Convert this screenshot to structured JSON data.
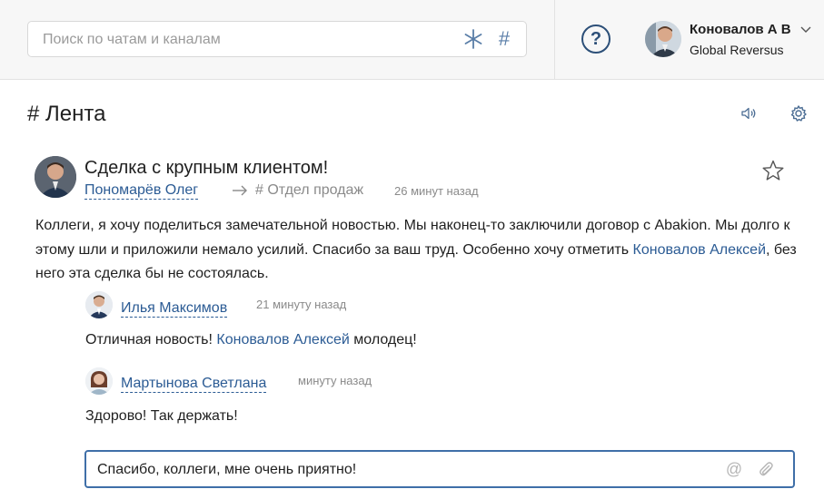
{
  "header": {
    "search": {
      "placeholder": "Поиск по чатам и каналам",
      "value": ""
    },
    "hash_symbol": "#",
    "help_symbol": "?",
    "user": {
      "name": "Коновалов А В",
      "company": "Global Reversus"
    }
  },
  "channel": {
    "title": "# Лента"
  },
  "post": {
    "title": "Сделка с крупным клиентом!",
    "author": "Пономарёв Олег",
    "channel": "# Отдел продаж",
    "time": "26 минут назад",
    "body_part1": "Коллеги, я хочу поделиться замечательной новостью. Мы наконец-то заключили договор с Abakion. Мы долго к этому шли и приложили немало усилий. Спасибо за ваш труд. Особенно хочу отметить ",
    "body_mention": "Коновалов Алексей",
    "body_part2": ", без него эта сделка бы не состоялась."
  },
  "comments": [
    {
      "author": "Илья Максимов",
      "time": "21 минуту назад",
      "text_part1": "Отличная новость! ",
      "text_mention": "Коновалов Алексей",
      "text_part2": " молодец!"
    },
    {
      "author": "Мартынова Светлана",
      "time": "минуту назад",
      "text": "Здорово! Так держать!"
    }
  ],
  "reply": {
    "value": "Спасибо, коллеги, мне очень приятно!",
    "at_symbol": "@"
  },
  "colors": {
    "link": "#2b5b94",
    "accent": "#3f6fa8",
    "muted": "#8a8a8a"
  }
}
